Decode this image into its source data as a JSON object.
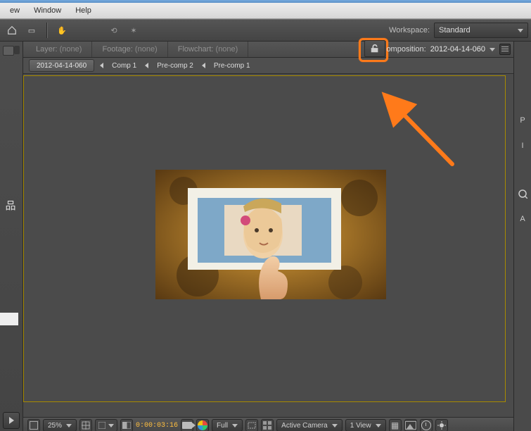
{
  "menu": {
    "items": [
      "ew",
      "Window",
      "Help"
    ]
  },
  "toolbar": {
    "workspace_label": "Workspace:",
    "workspace_value": "Standard"
  },
  "viewer_tabs": {
    "layer_label": "Layer:",
    "layer_value": "(none)",
    "footage_label": "Footage:",
    "footage_value": "(none)",
    "flowchart_label": "Flowchart:",
    "flowchart_value": "(none)",
    "composition_label": "omposition:",
    "composition_value": "2012-04-14-060"
  },
  "crumbs": {
    "root": "2012-04-14-060",
    "items": [
      "Comp 1",
      "Pre-comp 2",
      "Pre-comp 1"
    ]
  },
  "viewer_bar": {
    "zoom": "25%",
    "timecode": "0:00:03:16",
    "resolution": "Full",
    "camera": "Active Camera",
    "view_count": "1 View"
  },
  "right_labels": [
    "P",
    "I",
    "",
    "A"
  ],
  "icon_glyphs": {
    "hand": "✋",
    "select": "▭",
    "misc1": "⟲",
    "misc2": "✶",
    "hier": "品"
  },
  "colors": {
    "highlight": "#ff7a1a",
    "guide": "#a88b00",
    "timecode": "#ffbf3f"
  }
}
